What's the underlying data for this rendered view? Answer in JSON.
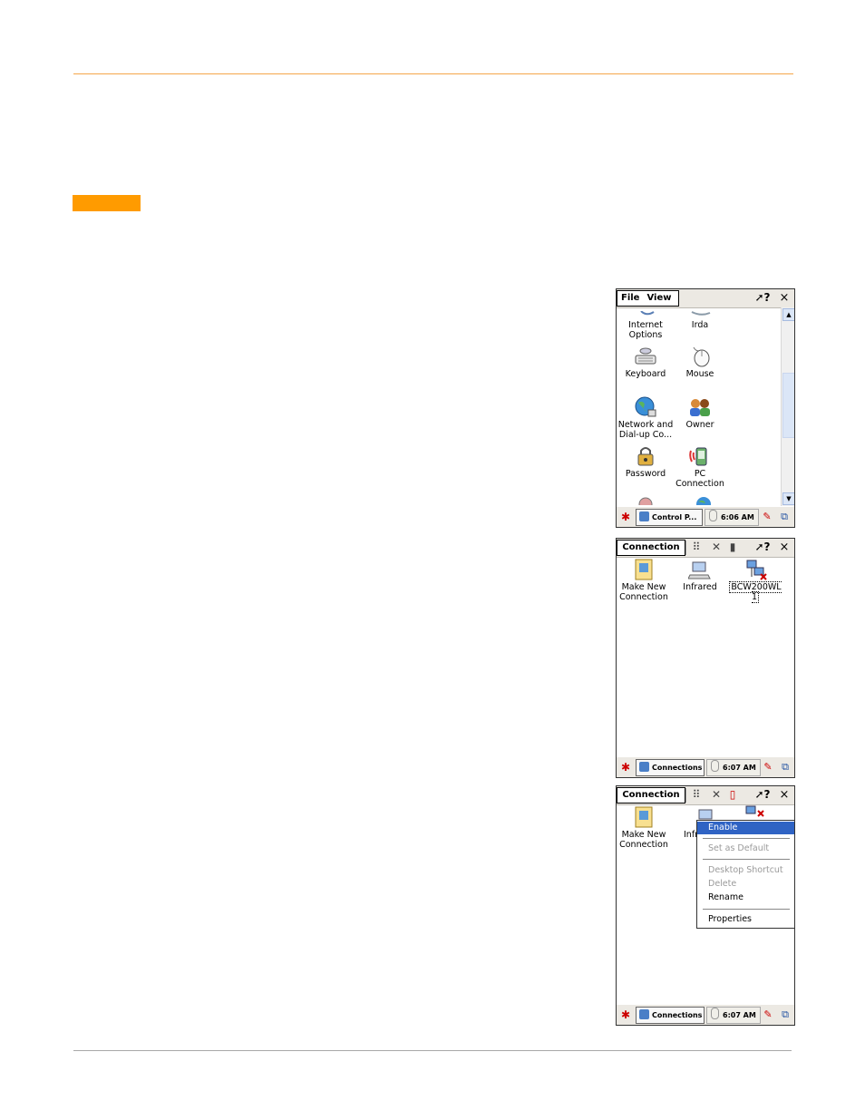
{
  "screens": {
    "control_panel": {
      "menu": {
        "file": "File",
        "view": "View"
      },
      "help": "?",
      "close": "×",
      "items": [
        {
          "label": "Internet Options",
          "icon": "internet-options-icon"
        },
        {
          "label": "Irda",
          "icon": "irda-icon"
        },
        {
          "label": "Keyboard",
          "icon": "keyboard-icon"
        },
        {
          "label": "Mouse",
          "icon": "mouse-icon"
        },
        {
          "label": "Network and Dial-up Co...",
          "icon": "network-icon"
        },
        {
          "label": "Owner",
          "icon": "owner-icon"
        },
        {
          "label": "Password",
          "icon": "password-icon"
        },
        {
          "label": "PC Connection",
          "icon": "pc-connection-icon"
        }
      ],
      "taskbar": {
        "task": "Control P...",
        "time": "6:06 AM"
      }
    },
    "connection": {
      "menu": {
        "connection": "Connection"
      },
      "help": "?",
      "close": "×",
      "items": [
        {
          "label": "Make New Connection",
          "icon": "make-new-connection-icon"
        },
        {
          "label": "Infrared",
          "icon": "infrared-icon"
        },
        {
          "label": "BCW200WL 1",
          "icon": "network-adapter-disabled-icon"
        }
      ],
      "taskbar": {
        "task": "Connections",
        "time": "6:07 AM"
      }
    },
    "connection_menu": {
      "menu": {
        "connection": "Connection"
      },
      "help": "?",
      "close": "×",
      "items": [
        {
          "label": "Make New Connection",
          "icon": "make-new-connection-icon"
        },
        {
          "label": "Infr",
          "icon": "infrared-icon"
        }
      ],
      "context_menu": [
        {
          "label": "Enable",
          "state": "selected"
        },
        {
          "label": "Set as Default",
          "state": "disabled"
        },
        {
          "label": "Desktop Shortcut",
          "state": "disabled"
        },
        {
          "label": "Delete",
          "state": "disabled"
        },
        {
          "label": "Rename",
          "state": "enabled"
        },
        {
          "label": "Properties",
          "state": "enabled"
        }
      ],
      "taskbar": {
        "task": "Connections",
        "time": "6:07 AM"
      }
    }
  },
  "colors": {
    "accent": "#ff9b00",
    "top_rule": "#f5a64a",
    "highlight": "#2f63c4"
  }
}
